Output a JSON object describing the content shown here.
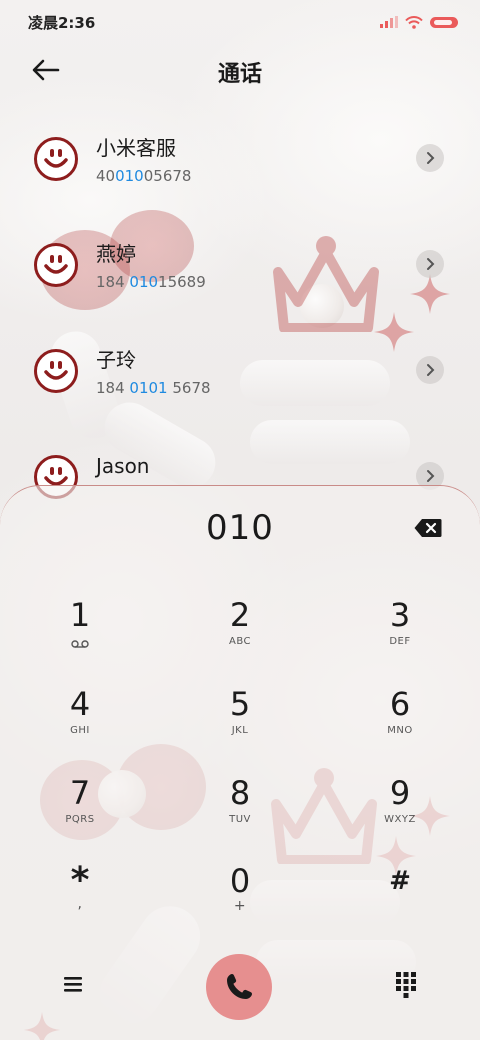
{
  "status_bar": {
    "time": "凌晨2:36",
    "icons": [
      "signal-icon",
      "wifi-icon",
      "battery-icon"
    ],
    "battery_color": "#ea5a5a"
  },
  "header": {
    "title": "通话",
    "back_icon": "arrow-left-icon"
  },
  "contacts": [
    {
      "name": "小米客服",
      "number_pre": "40",
      "number_match": "010",
      "number_post": "05678"
    },
    {
      "name": "燕婷",
      "number_pre": "184 ",
      "number_match": "010",
      "number_post": "15689"
    },
    {
      "name": "子玲",
      "number_pre": "184 ",
      "number_match": "0101",
      "number_post": " 5678"
    },
    {
      "name": "Jason",
      "number_pre": "",
      "number_match": "",
      "number_post": ""
    }
  ],
  "dialer": {
    "input": "010",
    "delete_icon": "backspace-icon",
    "keys": [
      {
        "digit": "1",
        "letters": ""
      },
      {
        "digit": "2",
        "letters": "ABC"
      },
      {
        "digit": "3",
        "letters": "DEF"
      },
      {
        "digit": "4",
        "letters": "GHI"
      },
      {
        "digit": "5",
        "letters": "JKL"
      },
      {
        "digit": "6",
        "letters": "MNO"
      },
      {
        "digit": "7",
        "letters": "PQRS"
      },
      {
        "digit": "8",
        "letters": "TUV"
      },
      {
        "digit": "9",
        "letters": "WXYZ"
      },
      {
        "digit": "*",
        "letters": ","
      },
      {
        "digit": "0",
        "letters": "+"
      },
      {
        "digit": "#",
        "letters": ""
      }
    ],
    "bottom": {
      "menu_icon": "menu-icon",
      "call_icon": "phone-icon",
      "keypad_icon": "dialpad-icon",
      "call_color": "#e68f8f"
    }
  },
  "colors": {
    "match_highlight": "#1f8ae0",
    "avatar_accent": "#8d1d1d",
    "sheet_border": "#c98b88"
  }
}
